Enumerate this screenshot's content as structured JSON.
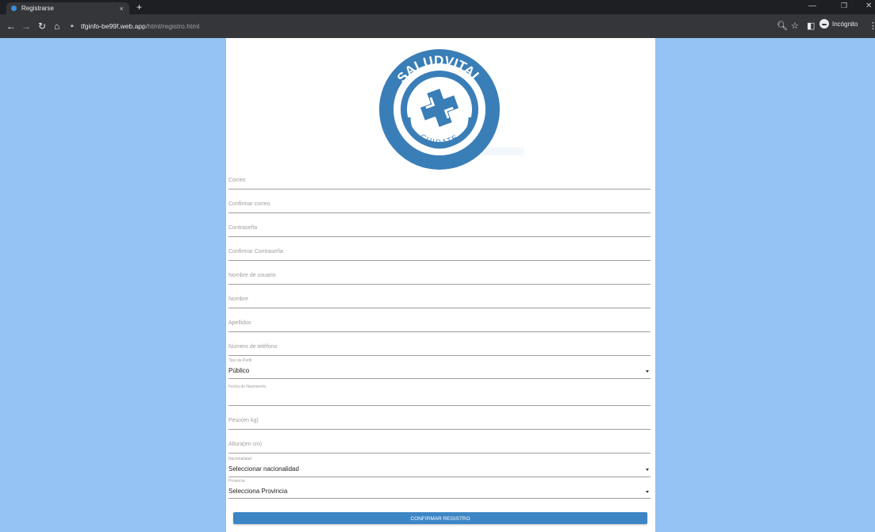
{
  "browser": {
    "tab_title": "Registrarse",
    "tab_close": "×",
    "new_tab": "+",
    "url_domain": "tfginfo-be99f.web.app",
    "url_path": "/html/registro.html",
    "profile_label": "Incógnito",
    "window_controls": [
      "minimize-icon",
      "restore-icon",
      "close-icon"
    ]
  },
  "logo": {
    "brand": "SALUDVITAL",
    "tagline": "CUIDATE",
    "colors": {
      "primary": "#3a7eb8",
      "white": "#ffffff"
    }
  },
  "form": {
    "fields": {
      "correo": {
        "placeholder": "Correo"
      },
      "confirmar_correo": {
        "placeholder": "Confirmar correo"
      },
      "contrasena": {
        "placeholder": "Contraseña"
      },
      "confirmar_contrasena": {
        "placeholder": "Confirmar Contraseña"
      },
      "nombre_usuario": {
        "placeholder": "Nombre de usuario"
      },
      "nombre": {
        "placeholder": "Nombre"
      },
      "apellidos": {
        "placeholder": "Apellidos"
      },
      "telefono": {
        "placeholder": "Número de teléfono"
      },
      "tipo_perfil": {
        "label": "Tipo de Perfil",
        "value": "Público"
      },
      "fecha_nacimiento": {
        "label": "Fecha de Nacimiento",
        "value": ""
      },
      "peso": {
        "placeholder": "Peso(en kg)"
      },
      "altura": {
        "placeholder": "Altura(en cm)"
      },
      "nacionalidad": {
        "label": "Nacionalidad",
        "value": "Seleccionar nacionalidad"
      },
      "provincia": {
        "label": "Provincia",
        "value": "Selecciona Provincia"
      }
    },
    "submit_label": "CONFIRMAR REGISTRO"
  },
  "colors": {
    "page_background": "#93c2f3",
    "card_background": "#ffffff",
    "button": "#3d86c6",
    "chrome_dark": "#1d1f23",
    "chrome_toolbar": "#35363a"
  }
}
